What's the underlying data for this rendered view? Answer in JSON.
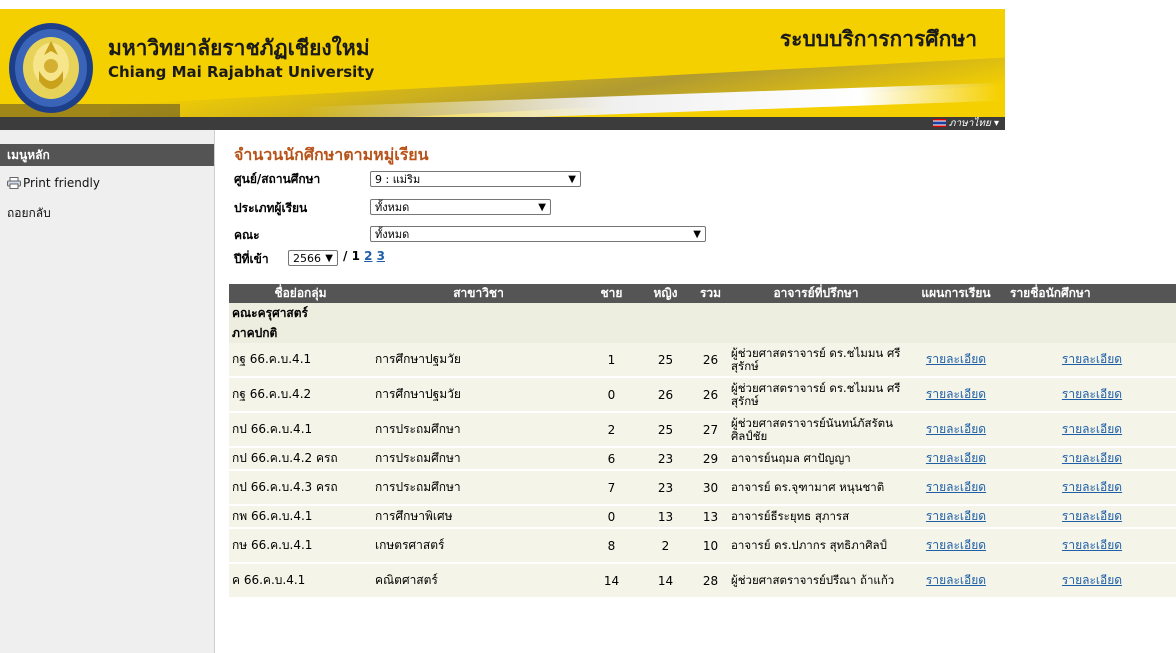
{
  "header": {
    "university_th": "มหาวิทยาลัยราชภัฏเชียงใหม่",
    "university_en": "Chiang Mai Rajabhat University",
    "system_name": "ระบบบริการการศึกษา",
    "language": "ภาษาไทย ▾",
    "logo_icon": "university-seal"
  },
  "sidebar": {
    "menu_title": "เมนูหลัก",
    "print_label": "Print friendly",
    "back_label": "ถอยกลับ"
  },
  "page": {
    "title": "จำนวนนักศึกษาตามหมู่เรียน",
    "filters": {
      "center_label": "ศูนย์/สถานศึกษา",
      "center_value": "9 : แม่ริม",
      "learner_type_label": "ประเภทผู้เรียน",
      "learner_type_value": "ทั้งหมด",
      "faculty_label": "คณะ",
      "faculty_value": "ทั้งหมด",
      "year_label": "ปีที่เข้า",
      "year_value": "2566",
      "pages_prefix": "/",
      "page_current": "1",
      "page_2": "2",
      "page_3": "3"
    }
  },
  "table": {
    "headers": [
      "ชื่อย่อกลุ่ม",
      "สาขาวิชา",
      "ชาย",
      "หญิง",
      "รวม",
      "อาจารย์ที่ปรึกษา",
      "แผนการเรียน",
      "รายชื่อนักศึกษา"
    ],
    "faculty_group": "คณะครุศาสตร์",
    "section_group": "ภาคปกติ",
    "link_text": "รายละเอียด",
    "rows": [
      {
        "group": "กฐ 66.ค.บ.4.1",
        "major": "การศึกษาปฐมวัย",
        "male": "1",
        "female": "25",
        "total": "26",
        "advisor": "ผู้ช่วยศาสตราจารย์ ดร.ชไมมน ศรีสุรักษ์"
      },
      {
        "group": "กฐ 66.ค.บ.4.2",
        "major": "การศึกษาปฐมวัย",
        "male": "0",
        "female": "26",
        "total": "26",
        "advisor": "ผู้ช่วยศาสตราจารย์ ดร.ชไมมน ศรีสุรักษ์"
      },
      {
        "group": "กป 66.ค.บ.4.1",
        "major": "การประถมศึกษา",
        "male": "2",
        "female": "25",
        "total": "27",
        "advisor": "ผู้ช่วยศาสตราจารย์นันทน์ภัสรัตนศิลป์ชัย"
      },
      {
        "group": "กป 66.ค.บ.4.2 ครถ",
        "major": "การประถมศึกษา",
        "male": "6",
        "female": "23",
        "total": "29",
        "advisor": "อาจารย์นฤมล ศาปัญญา"
      },
      {
        "group": "กป 66.ค.บ.4.3 ครถ",
        "major": "การประถมศึกษา",
        "male": "7",
        "female": "23",
        "total": "30",
        "advisor": "อาจารย์ ดร.จุฑามาศ หนุนชาติ"
      },
      {
        "group": "กพ 66.ค.บ.4.1",
        "major": "การศึกษาพิเศษ",
        "male": "0",
        "female": "13",
        "total": "13",
        "advisor": "อาจารย์ธีระยุทธ สุภารส"
      },
      {
        "group": "กษ 66.ค.บ.4.1",
        "major": "เกษตรศาสตร์",
        "male": "8",
        "female": "2",
        "total": "10",
        "advisor": "อาจารย์ ดร.ปภากร สุทธิภาศิลป์"
      },
      {
        "group": "ค 66.ค.บ.4.1",
        "major": "คณิตศาสตร์",
        "male": "14",
        "female": "14",
        "total": "28",
        "advisor": "ผู้ช่วยศาสตราจารย์ปรีณา ถ้าแก้ว"
      }
    ]
  }
}
